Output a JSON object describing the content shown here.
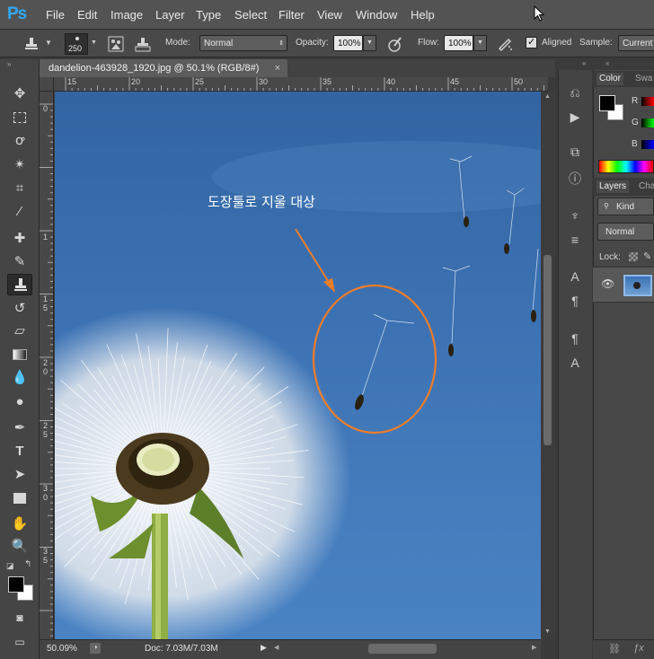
{
  "app": {
    "logo": "Ps"
  },
  "menu": [
    "File",
    "Edit",
    "Image",
    "Layer",
    "Type",
    "Select",
    "Filter",
    "View",
    "Window",
    "Help"
  ],
  "options": {
    "brush_size": "250",
    "mode_label": "Mode:",
    "mode_value": "Normal",
    "opacity_label": "Opacity:",
    "opacity_value": "100%",
    "flow_label": "Flow:",
    "flow_value": "100%",
    "aligned_label": "Aligned",
    "aligned_checked": true,
    "sample_label": "Sample:",
    "sample_value": "Current"
  },
  "document": {
    "tab_title": "dandelion-463928_1920.jpg @ 50.1% (RGB/8#)",
    "close_glyph": "×",
    "annotation": "도장툴로 지울 대상",
    "annotation_color": "#f07d28"
  },
  "rulers": {
    "h_ticks": [
      "15",
      "20",
      "25",
      "30",
      "35",
      "40",
      "45",
      "50"
    ],
    "v_ticks": [
      "0",
      "1",
      "1",
      "5",
      "2",
      "0",
      "2",
      "5",
      "3",
      "0",
      "3",
      "5"
    ]
  },
  "status": {
    "zoom": "50.09%",
    "doc_size": "Doc: 7.03M/7.03M"
  },
  "panels": {
    "color_tab": "Color",
    "swatches_tab": "Swa",
    "r_label": "R",
    "g_label": "G",
    "b_label": "B",
    "layers_tab": "Layers",
    "channels_tab": "Cha",
    "kind_label": "Kind",
    "blend_mode": "Normal",
    "lock_label": "Lock:"
  },
  "colors": {
    "accent": "#31a8ff",
    "foreground": "#000000",
    "background": "#ffffff"
  }
}
